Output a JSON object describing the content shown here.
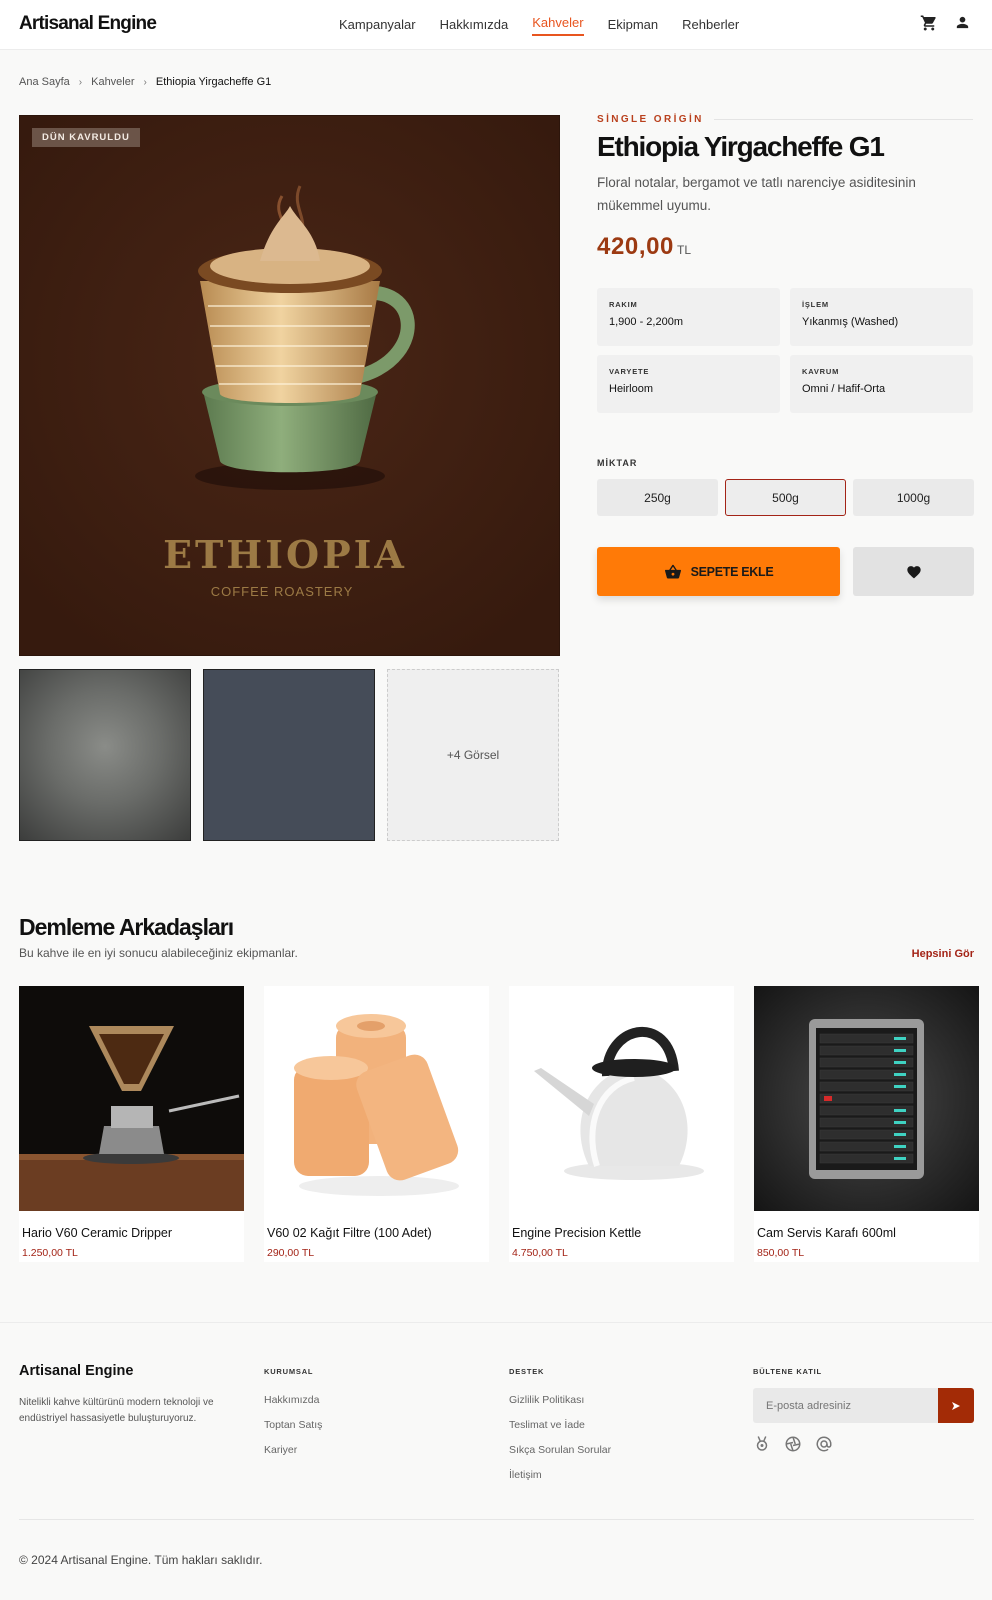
{
  "header": {
    "logo": "Artisanal Engine",
    "nav": [
      "Kampanyalar",
      "Hakkımızda",
      "Kahveler",
      "Ekipman",
      "Rehberler"
    ],
    "active_nav": "Kahveler",
    "icons": [
      "cart-icon",
      "user-icon"
    ]
  },
  "breadcrumb": [
    "Ana Sayfa",
    "Kahveler",
    "Ethiopia Yirgacheffe G1"
  ],
  "gallery": {
    "badge": "DÜN KAVRULDU",
    "more_label": "+4 Görsel"
  },
  "product": {
    "eyebrow": "SİNGLE ORİGİN",
    "title": "Ethiopia Yirgacheffe G1",
    "description": "Floral notalar, bergamot ve tatlı narenciye asiditesinin mükemmel uyumu.",
    "price": "420,00",
    "currency": "TL",
    "specs": [
      {
        "label": "RAKIM",
        "value": "1,900 - 2,200m"
      },
      {
        "label": "İŞLEM",
        "value": "Yıkanmış (Washed)"
      },
      {
        "label": "VARYETE",
        "value": "Heirloom"
      },
      {
        "label": "KAVRUM",
        "value": "Omni / Hafif-Orta"
      }
    ],
    "quantity_label": "MİKTAR",
    "quantities": [
      "250g",
      "500g",
      "1000g"
    ],
    "selected_quantity": "500g",
    "add_to_cart": "SEPETE EKLE"
  },
  "related": {
    "title": "Demleme Arkadaşları",
    "subtitle": "Bu kahve ile en iyi sonucu alabileceğiniz ekipmanlar.",
    "see_all": "Hepsini Gör",
    "items": [
      {
        "name": "Hario V60 Ceramic Dripper",
        "price": "1.250,00 TL"
      },
      {
        "name": "V60 02 Kağıt Filtre (100 Adet)",
        "price": "290,00 TL"
      },
      {
        "name": "Engine Precision Kettle",
        "price": "4.750,00 TL"
      },
      {
        "name": "Cam Servis Karafı 600ml",
        "price": "850,00 TL"
      }
    ]
  },
  "footer": {
    "brand": "Artisanal Engine",
    "about": "Nitelikli kahve kültürünü modern teknoloji ve endüstriyel hassasiyetle buluşturuyoruz.",
    "corporate": {
      "heading": "KURUMSAL",
      "links": [
        "Hakkımızda",
        "Toptan Satış",
        "Kariyer"
      ]
    },
    "support": {
      "heading": "DESTEK",
      "links": [
        "Gizlilik Politikası",
        "Teslimat ve İade",
        "Sıkça Sorulan Sorular",
        "İletişim"
      ]
    },
    "newsletter": {
      "heading": "BÜLTENE KATIL",
      "placeholder": "E-posta adresiniz"
    },
    "social_icons": [
      "award-icon",
      "aperture-icon",
      "at-icon"
    ],
    "copyright": "© 2024 Artisanal Engine. Tüm hakları saklıdır."
  },
  "colors": {
    "accent": "#ff7a07",
    "brand_red": "#a32417",
    "nav_active": "#e8551f",
    "price": "#9c3a12"
  }
}
